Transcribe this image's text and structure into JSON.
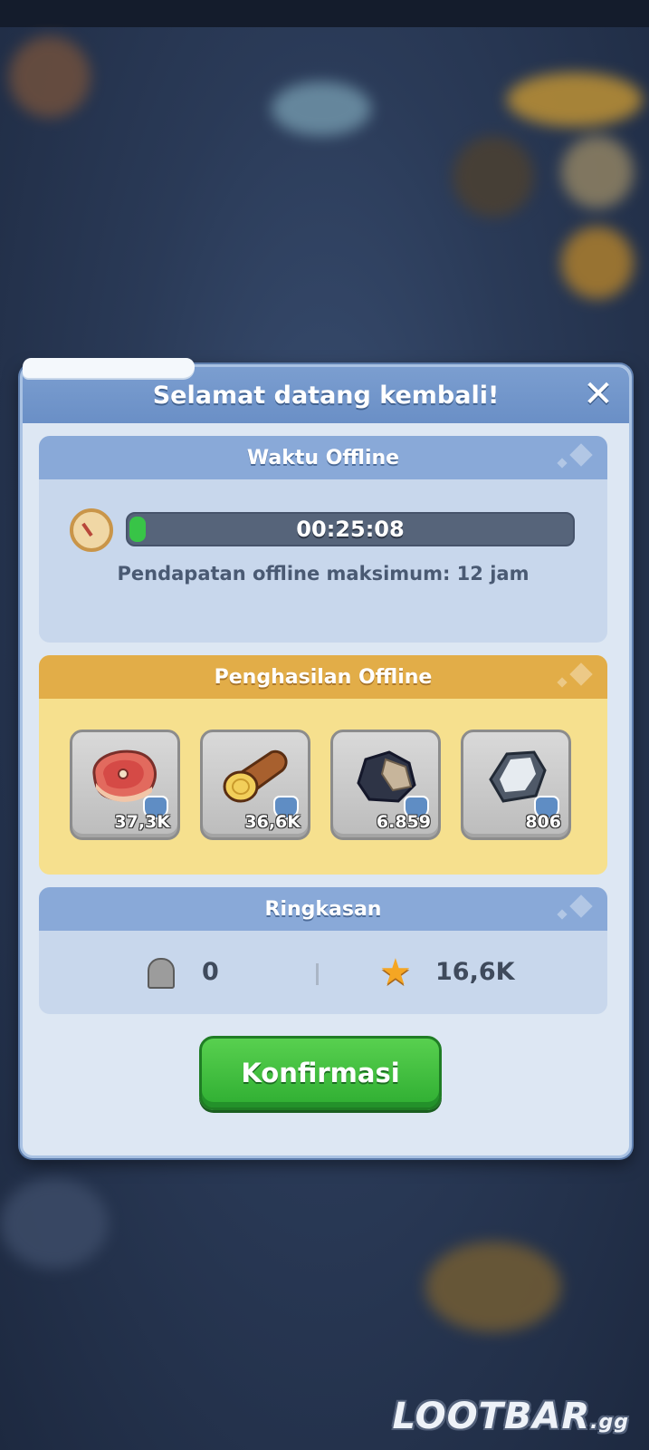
{
  "dialog": {
    "title": "Selamat datang kembali!",
    "close_label": "✕"
  },
  "offline_time": {
    "header": "Waktu Offline",
    "timer": "00:25:08",
    "progress_fraction": 0.035,
    "max_text": "Pendapatan offline maksimum: 12 jam"
  },
  "offline_earnings": {
    "header": "Penghasilan Offline",
    "items": [
      {
        "icon": "meat-icon",
        "amount": "37,3K"
      },
      {
        "icon": "wood-log-icon",
        "amount": "36,6K"
      },
      {
        "icon": "coal-ore-icon",
        "amount": "6.859"
      },
      {
        "icon": "iron-ore-icon",
        "amount": "806"
      }
    ]
  },
  "summary": {
    "header": "Ringkasan",
    "tombstone_count": "0",
    "star_count": "16,6K"
  },
  "confirm_label": "Konfirmasi",
  "watermark": {
    "brand": "LOOTBAR",
    "suffix": ".gg"
  },
  "colors": {
    "header_blue": "#7b9ed0",
    "gold_header": "#e2ad48",
    "progress_green": "#38c447",
    "confirm_green": "#3fbf3d"
  }
}
